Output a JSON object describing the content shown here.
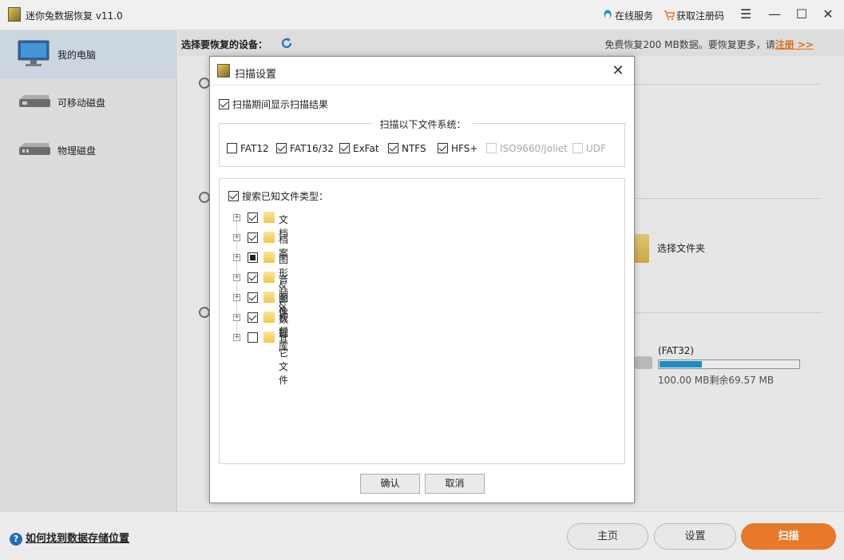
{
  "window": {
    "title": "迷你兔数据恢复 v11.0",
    "online_service": "在线服务",
    "get_code": "获取注册码",
    "menu_glyph": "☰",
    "minimize_glyph": "—",
    "maximize_glyph": "☐",
    "close_glyph": "✕"
  },
  "sidebar": {
    "items": [
      {
        "label": "我的电脑",
        "icon": "monitor-icon",
        "active": true
      },
      {
        "label": "可移动磁盘",
        "icon": "removable-disk-icon",
        "active": false
      },
      {
        "label": "物理磁盘",
        "icon": "physical-disk-icon",
        "active": false
      }
    ]
  },
  "main": {
    "select_device": "选择要恢复的设备：",
    "promo_text": "免费恢复200 MB数据。要恢复更多，请",
    "promo_link": "注册 >>",
    "choose_folder": "选择文件夹",
    "drive": {
      "fs": "(FAT32)",
      "size_text": "100.00 MB剩余69.57 MB",
      "used_fraction": 0.3
    }
  },
  "bottom": {
    "help_glyph": "?",
    "help_link": "如何找到数据存储位置",
    "home": "主页",
    "settings": "设置",
    "scan": "扫描"
  },
  "dialog": {
    "title": "扫描设置",
    "close_glyph": "✕",
    "show_results": {
      "label": "扫描期间显示扫描结果",
      "checked": true
    },
    "fs_legend": "扫描以下文件系统：",
    "filesystems": [
      {
        "label": "FAT12",
        "checked": false,
        "disabled": false
      },
      {
        "label": "FAT16/32",
        "checked": true,
        "disabled": false
      },
      {
        "label": "ExFat",
        "checked": true,
        "disabled": false
      },
      {
        "label": "NTFS",
        "checked": true,
        "disabled": false
      },
      {
        "label": "HFS+",
        "checked": true,
        "disabled": false
      },
      {
        "label": "ISO9660/Joliet",
        "checked": false,
        "disabled": true
      },
      {
        "label": "UDF",
        "checked": false,
        "disabled": true
      }
    ],
    "known_types": {
      "label": "搜索已知文件类型：",
      "checked": true
    },
    "types": [
      {
        "label": "文档",
        "state": "checked"
      },
      {
        "label": "档案",
        "state": "checked"
      },
      {
        "label": "图形 & 图像",
        "state": "partial"
      },
      {
        "label": "音频 & 视频",
        "state": "checked"
      },
      {
        "label": "邮件",
        "state": "checked"
      },
      {
        "label": "数据库",
        "state": "checked"
      },
      {
        "label": "其它文件",
        "state": "unchecked"
      }
    ],
    "ok": "确认",
    "cancel": "取消"
  }
}
